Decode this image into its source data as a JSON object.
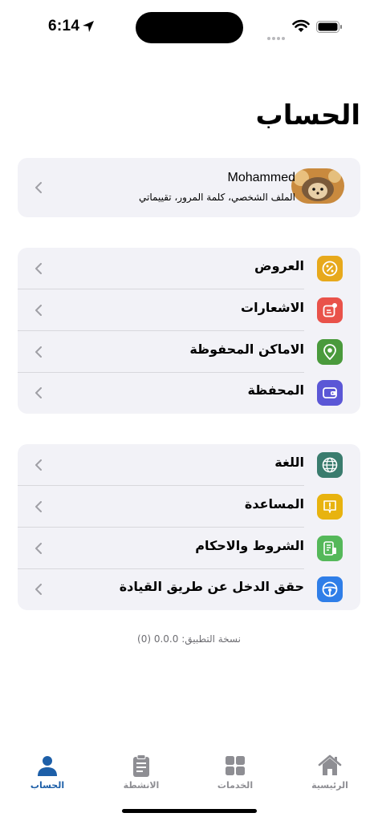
{
  "status_bar": {
    "time": "6:14"
  },
  "page": {
    "title": "الحساب"
  },
  "profile": {
    "name": "Mohammed",
    "subtitle": "الملف الشخصي، كلمة المرور، تقييماتي"
  },
  "group1": [
    {
      "label": "العروض",
      "icon": "percent-icon",
      "color": "#e7a91c"
    },
    {
      "label": "الاشعارات",
      "icon": "notification-icon",
      "color": "#e9524a"
    },
    {
      "label": "الاماكن المحفوظة",
      "icon": "location-pin-icon",
      "color": "#4a9a3c"
    },
    {
      "label": "المحفظة",
      "icon": "wallet-icon",
      "color": "#5b57d6"
    }
  ],
  "group2": [
    {
      "label": "اللغة",
      "icon": "globe-icon",
      "color": "#3a7c6e"
    },
    {
      "label": "المساعدة",
      "icon": "help-icon",
      "color": "#e8b30f"
    },
    {
      "label": "الشروط والاحكام",
      "icon": "document-icon",
      "color": "#55b85a"
    },
    {
      "label": "حقق الدخل عن طريق القيادة",
      "icon": "steering-wheel-icon",
      "color": "#2f7ee8"
    }
  ],
  "version": "نسخة التطبيق: 0.0.0 (0)",
  "tabs": [
    {
      "label": "الحساب",
      "icon": "person-icon",
      "active": true
    },
    {
      "label": "الانشطة",
      "icon": "clipboard-icon",
      "active": false
    },
    {
      "label": "الخدمات",
      "icon": "grid-icon",
      "active": false
    },
    {
      "label": "الرئيسية",
      "icon": "home-icon",
      "active": false
    }
  ],
  "colors": {
    "active_tab": "#1d5fa8",
    "inactive_tab": "#8e8e93",
    "card_bg": "#f2f2f7"
  }
}
